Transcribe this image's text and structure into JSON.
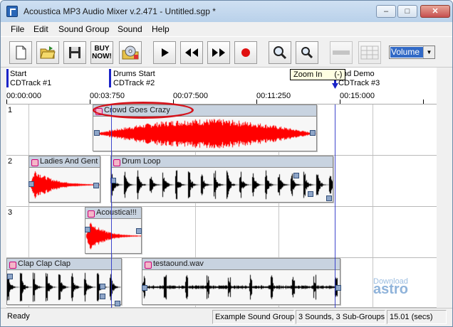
{
  "window": {
    "title": "Acoustica MP3 Audio Mixer v.2.471 - Untitled.sgp *"
  },
  "menu": [
    "File",
    "Edit",
    "Sound Group",
    "Sound",
    "Help"
  ],
  "toolbar": {
    "buy_now_label": "BUY\nNOW!",
    "volume_selected": "Volume",
    "tooltip": "Zoom In",
    "tooltip_extra": "(-)"
  },
  "ruler": {
    "markers": [
      {
        "name": "Start",
        "track": "CDTrack #1"
      },
      {
        "name": "Drums Start",
        "track": "CDTrack #2"
      },
      {
        "name": "nd Demo",
        "track": "CDTrack #3"
      }
    ],
    "timecodes": [
      "00:00:000",
      "00:03:750",
      "00:07:500",
      "00:11:250",
      "00:15:000"
    ]
  },
  "tracks": [
    {
      "number": "1"
    },
    {
      "number": "2"
    },
    {
      "number": "3"
    }
  ],
  "clips": [
    {
      "label": "Crowd Goes Crazy",
      "color": "#ff0000"
    },
    {
      "label": "Ladies And Gent",
      "color": "#ff0000"
    },
    {
      "label": "Drum Loop",
      "color": "#000000"
    },
    {
      "label": "Acoustica!!!",
      "color": "#ff0000"
    },
    {
      "label": "Clap Clap Clap",
      "color": "#000000"
    },
    {
      "label": "testaound.wav",
      "color": "#000000"
    }
  ],
  "status": {
    "state": "Ready",
    "group": "Example Sound Group",
    "counts": "3 Sounds, 3 Sub-Groups",
    "duration": "15.01 (secs)"
  },
  "watermark": {
    "top": "Download",
    "brand": "astro"
  }
}
